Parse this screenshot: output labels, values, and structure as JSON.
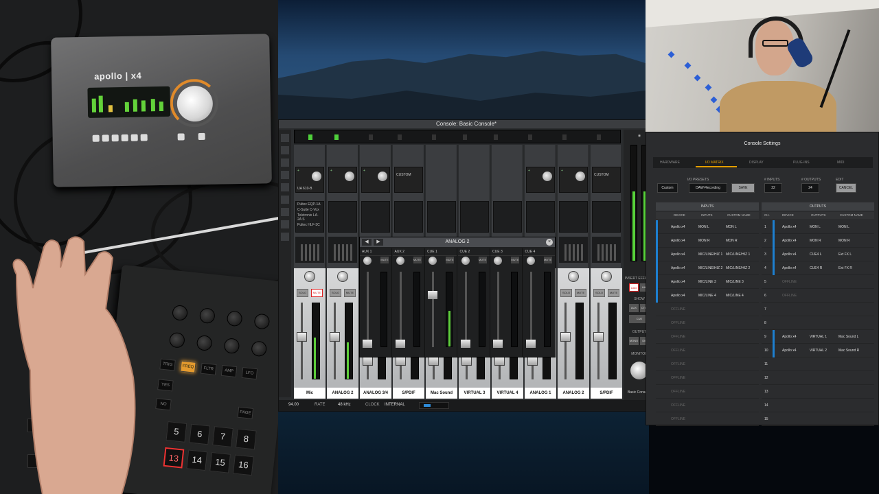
{
  "hardware": {
    "brand": "apollo",
    "model": "x4",
    "controller_pads": [
      "TRIG",
      "FREQ",
      "FLTR",
      "AMP",
      "LFO",
      "YES",
      "NO",
      "PAGE",
      "PTN",
      "SAVE"
    ],
    "controller_numbers": [
      "5",
      "6",
      "7",
      "8",
      "13",
      "14",
      "15",
      "16"
    ]
  },
  "console": {
    "title": "Console: Basic Console*",
    "strips": [
      {
        "label": "Mic",
        "preamp": "UA 610-B",
        "inserts": [
          "Pultec EQP-1A",
          "C-Suite C-Vox",
          "Teletronix LA-2A S",
          "Pultec HLF-3C"
        ],
        "fader": 0.62,
        "meter": 0.55,
        "mute": true
      },
      {
        "label": "ANALOG 2",
        "preamp": "",
        "inserts": [],
        "fader": 0.62,
        "meter": 0.48,
        "mute": false
      },
      {
        "label": "ANALOG 3/4",
        "preamp": "",
        "inserts": [],
        "fader": 0.3,
        "meter": 0.0,
        "mute": false
      },
      {
        "label": "S/PDIF",
        "preamp": "CUSTOM",
        "inserts": [],
        "fader": 0.3,
        "meter": 0.0,
        "mute": false
      },
      {
        "label": "Mac Sound",
        "preamp": "",
        "inserts": [],
        "fader": 0.3,
        "meter": 0.0,
        "mute": false
      },
      {
        "label": "VIRTUAL 3",
        "preamp": "",
        "inserts": [],
        "fader": 0.3,
        "meter": 0.0,
        "mute": false
      },
      {
        "label": "VIRTUAL 4",
        "preamp": "",
        "inserts": [],
        "fader": 0.3,
        "meter": 0.0,
        "mute": false
      },
      {
        "label": "ANALOG 1",
        "preamp": "",
        "inserts": [],
        "fader": 0.3,
        "meter": 0.0,
        "mute": false
      },
      {
        "label": "ANALOG 2",
        "preamp": "",
        "inserts": [],
        "fader": 0.62,
        "meter": 0.0,
        "mute": false
      },
      {
        "label": "S/PDIF",
        "preamp": "CUSTOM",
        "inserts": [],
        "fader": 0.62,
        "meter": 0.0,
        "mute": false
      }
    ],
    "send_panel": {
      "title": "ANALOG 2",
      "columns": [
        {
          "name": "AUX 1",
          "fader": 0.1,
          "meter": 0
        },
        {
          "name": "AUX 2",
          "fader": 0.1,
          "meter": 0
        },
        {
          "name": "CUE 1",
          "fader": 0.75,
          "meter": 0.48
        },
        {
          "name": "CUE 2",
          "fader": 0.1,
          "meter": 0
        },
        {
          "name": "CUE 3",
          "fader": 0.1,
          "meter": 0
        },
        {
          "name": "CUE 4",
          "fader": 0.1,
          "meter": 0
        }
      ]
    },
    "master": {
      "meter_l": 0.6,
      "meter_r": 0.6,
      "insert_effects": "INSERT EFFECTS",
      "show": "SHOW",
      "output": "OUTPUT",
      "monitor": "MONITOR",
      "session": "Basic Console*"
    },
    "status": {
      "tempo": "94.00",
      "rate_label": "RATE",
      "rate": "48 kHz",
      "clock_label": "CLOCK",
      "clock": "INTERNAL"
    }
  },
  "settings": {
    "title": "Console Settings",
    "tabs": [
      "HARDWARE",
      "I/O MATRIX",
      "DISPLAY",
      "PLUG-INS",
      "MIDI"
    ],
    "active_tab": 1,
    "io_preset_label": "I/O PRESETS",
    "io_preset": "DAW-Recording",
    "save_label": "SAVE",
    "custom": "Custom",
    "inputs_count_label": "# INPUTS",
    "inputs_count": "22",
    "outputs_count_label": "# OUTPUTS",
    "outputs_count": "24",
    "edit_label": "EDIT",
    "cancel_label": "CANCEL",
    "inputs_header": "INPUTS",
    "outputs_header": "OUTPUTS",
    "col_device": "DEVICE",
    "col_inputs": "INPUTS",
    "col_outputs": "OUTPUTS",
    "col_custom": "CUSTOM NAME",
    "col_ch": "CH.",
    "inputs": [
      {
        "device": "Apollo x4",
        "io": "MON L",
        "name": "MON L"
      },
      {
        "device": "Apollo x4",
        "io": "MON R",
        "name": "MON R"
      },
      {
        "device": "Apollo x4",
        "io": "MIC/LINE/HIZ 1",
        "name": "MIC/LINE/HIZ 1"
      },
      {
        "device": "Apollo x4",
        "io": "MIC/LINE/HIZ 2",
        "name": "MIC/LINE/HIZ 2"
      },
      {
        "device": "Apollo x4",
        "io": "MIC/LINE 3",
        "name": "MIC/LINE 3"
      },
      {
        "device": "Apollo x4",
        "io": "MIC/LINE 4",
        "name": "MIC/LINE 4"
      },
      {
        "device": "OFFLINE",
        "io": "",
        "name": ""
      },
      {
        "device": "OFFLINE",
        "io": "",
        "name": ""
      },
      {
        "device": "OFFLINE",
        "io": "",
        "name": ""
      },
      {
        "device": "OFFLINE",
        "io": "",
        "name": ""
      },
      {
        "device": "OFFLINE",
        "io": "",
        "name": ""
      },
      {
        "device": "OFFLINE",
        "io": "",
        "name": ""
      },
      {
        "device": "OFFLINE",
        "io": "",
        "name": ""
      },
      {
        "device": "OFFLINE",
        "io": "",
        "name": ""
      },
      {
        "device": "OFFLINE",
        "io": "",
        "name": ""
      }
    ],
    "outputs": [
      {
        "ch": "1",
        "device": "Apollo x4",
        "io": "MON L",
        "name": "MON L"
      },
      {
        "ch": "2",
        "device": "Apollo x4",
        "io": "MON R",
        "name": "MON R"
      },
      {
        "ch": "3",
        "device": "Apollo x4",
        "io": "CUE4 L",
        "name": "Ext FX L"
      },
      {
        "ch": "4",
        "device": "Apollo x4",
        "io": "CUE4 R",
        "name": "Ext FX R"
      },
      {
        "ch": "5",
        "device": "OFFLINE",
        "io": "",
        "name": ""
      },
      {
        "ch": "6",
        "device": "OFFLINE",
        "io": "",
        "name": ""
      },
      {
        "ch": "7",
        "device": "",
        "io": "",
        "name": ""
      },
      {
        "ch": "8",
        "device": "",
        "io": "",
        "name": ""
      },
      {
        "ch": "9",
        "device": "Apollo x4",
        "io": "VIRTUAL 1",
        "name": "Mac Sound L"
      },
      {
        "ch": "10",
        "device": "Apollo x4",
        "io": "VIRTUAL 2",
        "name": "Mac Sound R"
      },
      {
        "ch": "11",
        "device": "",
        "io": "",
        "name": ""
      },
      {
        "ch": "12",
        "device": "",
        "io": "",
        "name": ""
      },
      {
        "ch": "13",
        "device": "",
        "io": "",
        "name": ""
      },
      {
        "ch": "14",
        "device": "",
        "io": "",
        "name": ""
      },
      {
        "ch": "15",
        "device": "",
        "io": "",
        "name": ""
      }
    ]
  }
}
